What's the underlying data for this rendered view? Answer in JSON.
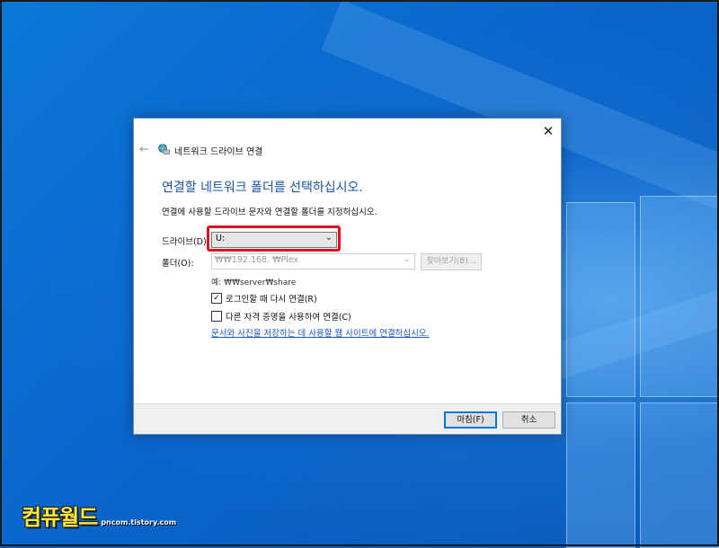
{
  "dialog": {
    "title": "네트워크 드라이브 연결",
    "back_icon": "←",
    "close_icon": "✕",
    "heading": "연결할 네트워크 폴더를 선택하십시오.",
    "subtext": "연결에 사용할 드라이브 문자와 연결할 폴더를 지정하십시오.",
    "drive_label": "드라이브(D):",
    "drive_value": "U:",
    "folder_label": "폴더(O):",
    "folder_value": "₩₩192.168.        ₩Plex",
    "browse_label": "찾아보기(B)...",
    "example_text": "예: ₩₩server₩share",
    "reconnect_label": "로그인할 때 다시 연결(R)",
    "reconnect_checked": true,
    "other_credentials_label": "다른 자격 증명을 사용하여 연결(C)",
    "other_credentials_checked": false,
    "link_text": "문서와 사진을 저장하는 데 사용할 웹 사이트에 연결하십시오.",
    "finish_label": "마침(F)",
    "cancel_label": "취소"
  },
  "watermark": {
    "logo": "컴퓨월드",
    "url": "pncom.tistory.com"
  },
  "colors": {
    "heading": "#1a56a6",
    "highlight": "#e3101a",
    "desktop": "#0a66cc"
  }
}
